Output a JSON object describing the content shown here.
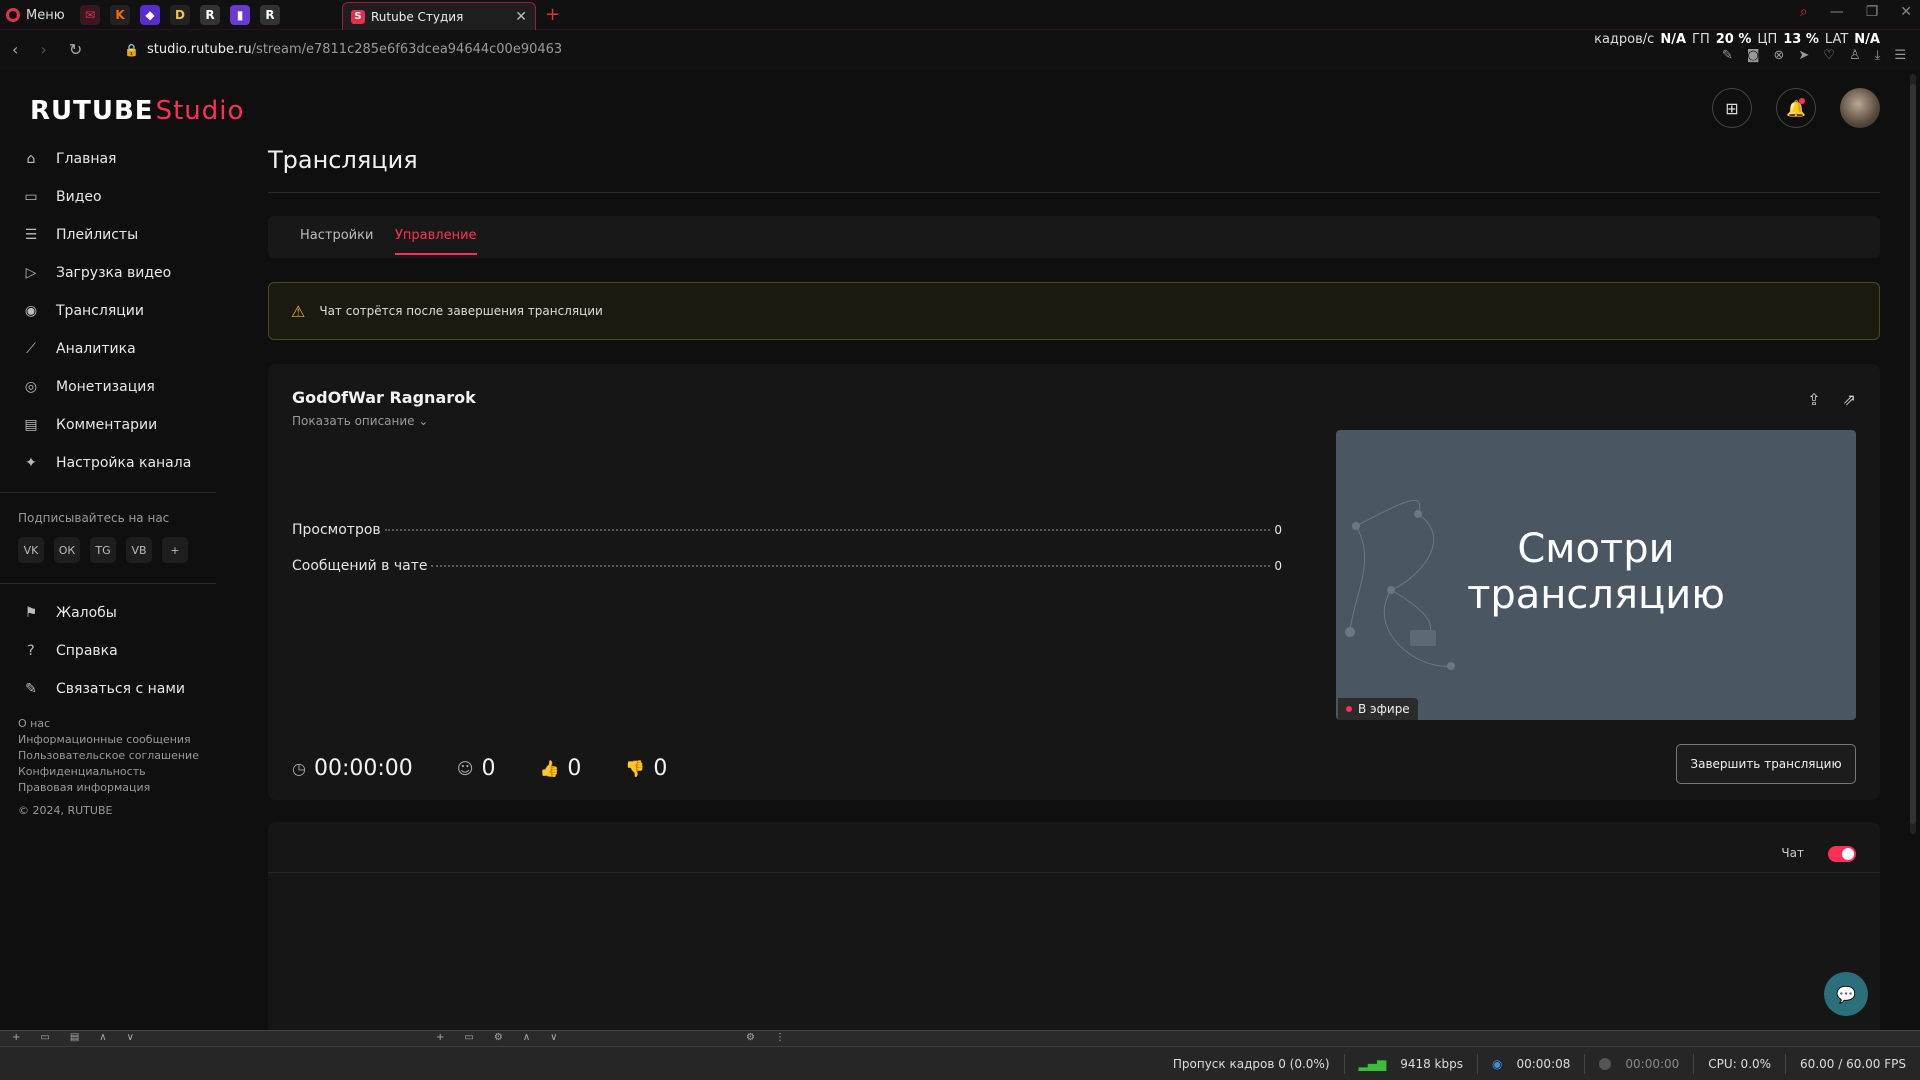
{
  "browser": {
    "menu_label": "Меню",
    "active_tab_title": "Rutube Студия",
    "url_host": "studio.rutube.ru",
    "url_path": "/stream/e7811c285e6f63dcea94644c00e90463",
    "perf": {
      "fps_label": "кадров/с",
      "fps_value": "N/A",
      "gpu_label": "ГП",
      "gpu_value": "20 %",
      "cpu_label": "ЦП",
      "cpu_value": "13 %",
      "lat_label": "LAT",
      "lat_value": "N/A"
    }
  },
  "app": {
    "logo_main": "RUTUBE",
    "logo_sub": "Studio",
    "page_title": "Трансляция",
    "nav": [
      {
        "label": "Главная",
        "icon": "home-icon"
      },
      {
        "label": "Видео",
        "icon": "video-icon"
      },
      {
        "label": "Плейлисты",
        "icon": "playlist-icon"
      },
      {
        "label": "Загрузка видео",
        "icon": "upload-icon"
      },
      {
        "label": "Трансляции",
        "icon": "broadcast-icon"
      },
      {
        "label": "Аналитика",
        "icon": "analytics-icon"
      },
      {
        "label": "Монетизация",
        "icon": "monetization-icon"
      },
      {
        "label": "Комментарии",
        "icon": "comments-icon"
      },
      {
        "label": "Настройка канала",
        "icon": "channel-settings-icon"
      }
    ],
    "subscribe_title": "Подписывайтесь на нас",
    "socials": [
      "VK",
      "ОК",
      "TG",
      "VB",
      "+"
    ],
    "nav_secondary": [
      {
        "label": "Жалобы",
        "icon": "flag-icon"
      },
      {
        "label": "Справка",
        "icon": "help-icon"
      },
      {
        "label": "Связаться с нами",
        "icon": "contact-icon"
      }
    ],
    "footer_links": [
      "О нас",
      "Информационные сообщения",
      "Пользовательское соглашение",
      "Конфиденциальность",
      "Правовая информация"
    ],
    "copyright": "© 2024, RUTUBE",
    "tabs": {
      "settings": "Настройки",
      "management": "Управление"
    },
    "alert_text": "Чат сотрётся после завершения трансляции",
    "stream": {
      "title": "GodOfWar Ragnarok",
      "show_description": "Показать описание",
      "views_label": "Просмотров",
      "views_value": "0",
      "chat_messages_label": "Сообщений в чате",
      "chat_messages_value": "0",
      "preview_line1": "Смотри",
      "preview_line2": "трансляцию",
      "live_badge": "В эфире",
      "end_button": "Завершить трансляцию",
      "duration": "00:00:00",
      "viewers": "0",
      "likes": "0",
      "dislikes": "0"
    },
    "chat_toggle_label": "Чат",
    "chat_enabled": true,
    "accent_color": "#ff2e55"
  },
  "obs_status": {
    "dropped_frames": "Пропуск кадров 0 (0.0%)",
    "bitrate": "9418 kbps",
    "stream_time": "00:00:08",
    "rec_time": "00:00:00",
    "cpu": "CPU: 0.0%",
    "fps": "60.00 / 60.00 FPS"
  }
}
